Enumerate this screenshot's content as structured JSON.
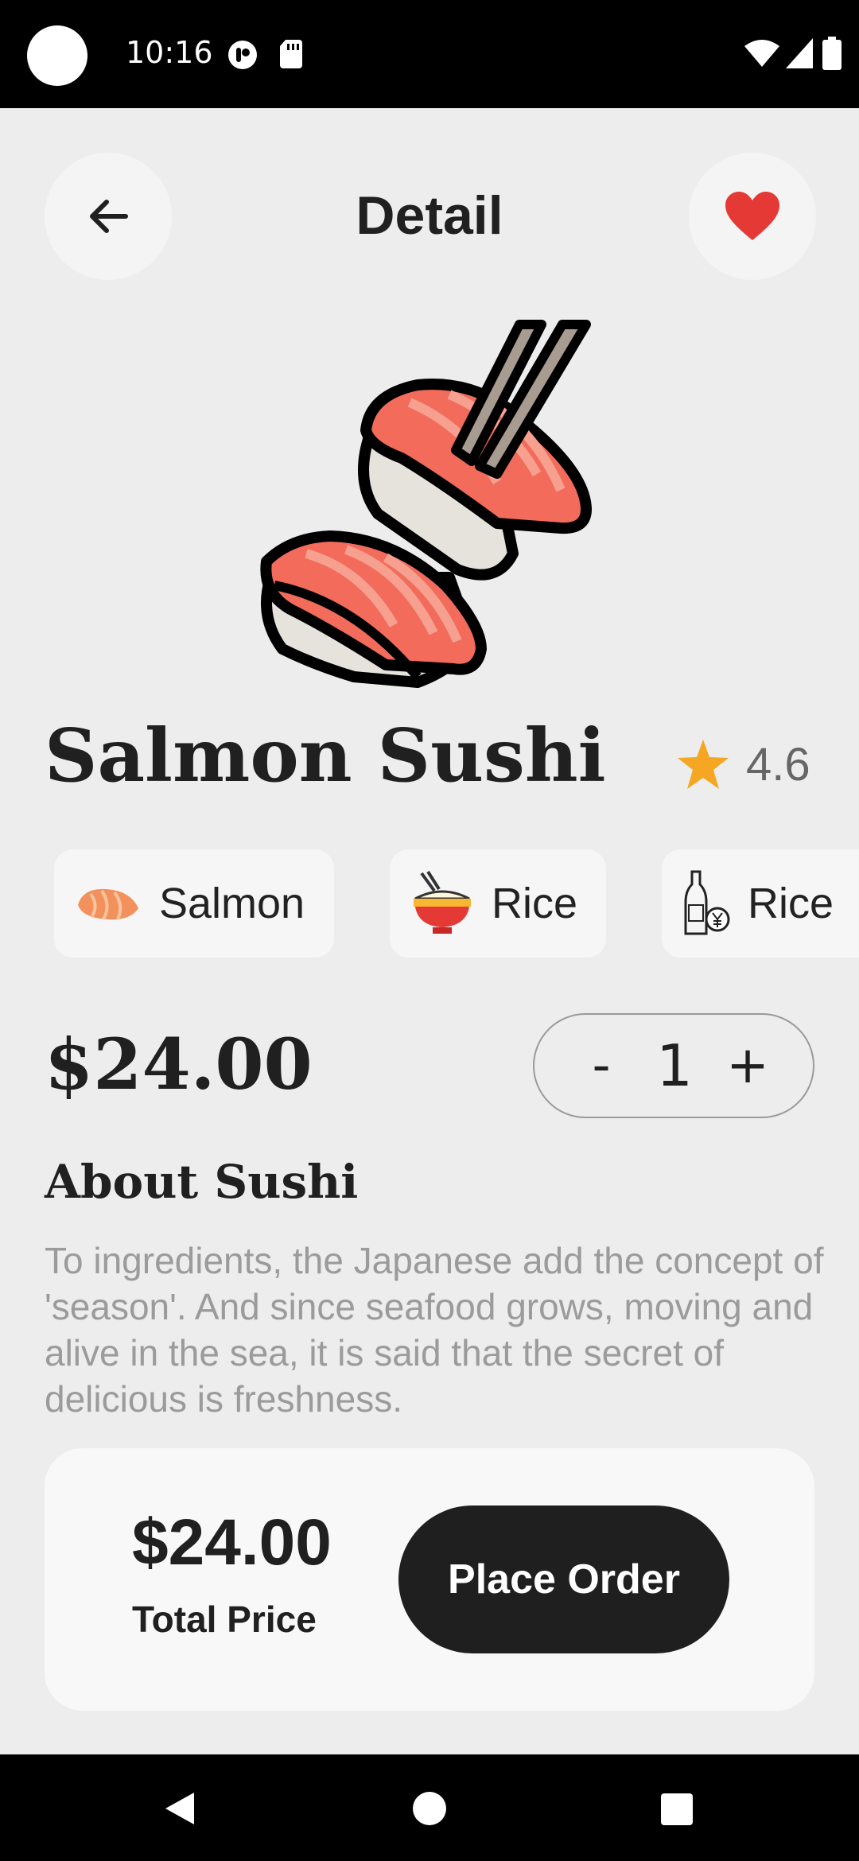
{
  "status_bar": {
    "time": "10:16"
  },
  "header": {
    "title": "Detail",
    "back_icon": "arrow-left-icon",
    "favorite_icon": "heart-icon",
    "favorite_color": "#e53935"
  },
  "food": {
    "name": "Salmon Sushi",
    "rating": "4.6",
    "rating_color": "#f5a623",
    "price": "$24.00"
  },
  "ingredients": [
    {
      "label": "Salmon",
      "icon": "salmon-icon"
    },
    {
      "label": "Rice",
      "icon": "rice-bowl-icon"
    },
    {
      "label": "Rice",
      "icon": "rice-wine-bottle-icon"
    }
  ],
  "quantity": {
    "minus": "-",
    "value": "1",
    "plus": "+"
  },
  "about": {
    "title": "About Sushi",
    "text": "To ingredients, the Japanese add the concept of 'season'. And since seafood grows, moving and alive in the sea, it is said that the secret of delicious is freshness."
  },
  "order": {
    "total_price": "$24.00",
    "total_label": "Total Price",
    "button_label": "Place Order"
  }
}
